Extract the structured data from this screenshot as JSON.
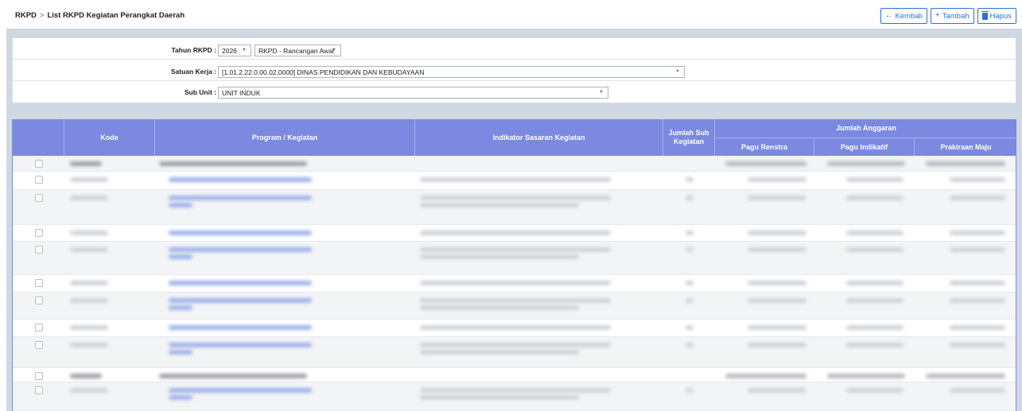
{
  "breadcrumb": {
    "root": "RKPD",
    "separator": ">",
    "current": "List RKPD Kegiatan Perangkat Daerah"
  },
  "toolbar": {
    "kembali_label": "Kembali",
    "tambah_label": "Tambah",
    "hapus_label": "Hapus",
    "kembali_icon": "arrow-left-icon",
    "tambah_icon": "plus-icon",
    "hapus_icon": "trash-icon"
  },
  "filters": {
    "tahun_label": "Tahun RKPD :",
    "tahun_value": "2026",
    "tahap_value": "RKPD - Rancangan Awal",
    "satker_label": "Satuan Kerja :",
    "satker_value": "[1.01.2.22.0.00.02.0000] DINAS PENDIDIKAN DAN KEBUDAYAAN",
    "subunit_label": "Sub Unit :",
    "subunit_value": "UNIT INDUK"
  },
  "table": {
    "headers": {
      "kode": "Kode",
      "program": "Program / Kegiatan",
      "indikator": "Indikator Sasaran Kegiatan",
      "jumlah_sub": "Jumlah Sub Kegiatan",
      "jumlah_anggaran": "Jumlah Anggaran",
      "pagu_renstra": "Pagu Renstra",
      "pagu_indikatif": "Pagu Indikatif",
      "prakiraan_maju": "Prakiraan Maju"
    },
    "note": "Row contents are blurred/redacted in the screenshot"
  },
  "colors": {
    "header_bg": "#7b8ae0",
    "accent": "#2c6fd8",
    "panel_bg": "#cfd8e3"
  }
}
